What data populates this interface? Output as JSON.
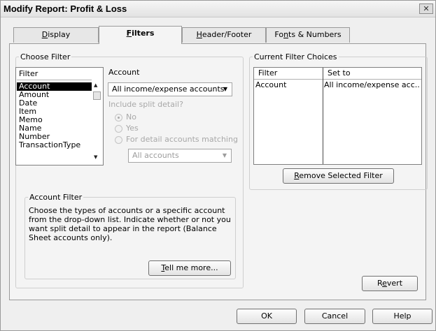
{
  "window": {
    "title": "Modify Report: Profit & Loss",
    "close_glyph": "✕"
  },
  "tabs": [
    {
      "label": "Display",
      "mnemonic": "D",
      "rest": "isplay"
    },
    {
      "label": "Filters",
      "mnemonic": "F",
      "rest": "ilters"
    },
    {
      "label": "Header/Footer",
      "mnemonic": "H",
      "rest": "eader/Footer"
    },
    {
      "label": "Fonts & Numbers",
      "pre": "Fo",
      "mnemonic": "n",
      "rest": "ts & Numbers"
    }
  ],
  "choose_filter": {
    "legend": "Choose Filter",
    "list_header": "Filter",
    "items": [
      "Account",
      "Amount",
      "Date",
      "Item",
      "Memo",
      "Name",
      "Number",
      "TransactionType"
    ],
    "selected": "Account",
    "account_label": "Account",
    "account_value": "All income/expense accounts",
    "split_detail_label": "Include split detail?",
    "radio_no": "No",
    "radio_yes": "Yes",
    "radio_matching": "For detail accounts matching",
    "matching_value": "All accounts"
  },
  "account_filter": {
    "legend": "Account Filter",
    "description": "Choose the types of accounts or a specific account from the drop-down list. Indicate whether or not you want split detail to appear in the report (Balance Sheet accounts only).",
    "tell_me_more": {
      "mnemonic": "T",
      "rest": "ell me more..."
    }
  },
  "current_filters": {
    "legend": "Current Filter Choices",
    "col_filter": "Filter",
    "col_set_to": "Set to",
    "rows": [
      {
        "filter": "Account",
        "set_to": "All income/expense acc..."
      }
    ],
    "remove_button": {
      "mnemonic": "R",
      "rest": "emove Selected Filter"
    }
  },
  "buttons": {
    "revert": {
      "pre": "R",
      "mnemonic": "e",
      "rest": "vert"
    },
    "ok": "OK",
    "cancel": "Cancel",
    "help": "Help"
  },
  "icons": {
    "scroll_up": "▲",
    "scroll_down": "▼",
    "dropdown": "▼"
  }
}
